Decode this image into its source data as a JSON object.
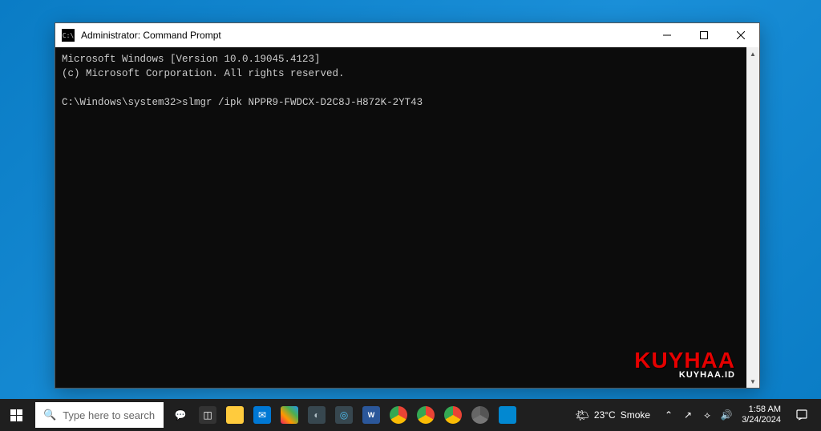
{
  "window": {
    "icon_label": "C:\\",
    "title": "Administrator: Command Prompt"
  },
  "terminal": {
    "line1": "Microsoft Windows [Version 10.0.19045.4123]",
    "line2": "(c) Microsoft Corporation. All rights reserved.",
    "prompt": "C:\\Windows\\system32>",
    "command": "slmgr /ipk NPPR9-FWDCX-D2C8J-H872K-2YT43"
  },
  "watermark": {
    "big": "KUYHAA",
    "small": "KUYHAA.ID"
  },
  "taskbar": {
    "search_placeholder": "Type here to search",
    "weather": {
      "temp": "23°C",
      "condition": "Smoke"
    },
    "clock": {
      "time": "1:58 AM",
      "date": "3/24/2024"
    }
  }
}
